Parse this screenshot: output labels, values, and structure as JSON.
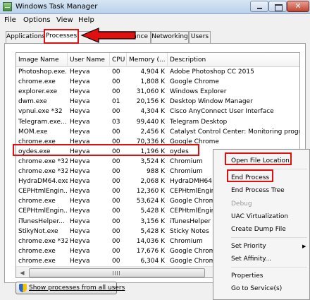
{
  "window": {
    "title": "Windows Task Manager",
    "close_glyph": "✕"
  },
  "menu": [
    "File",
    "Options",
    "View",
    "Help"
  ],
  "tabs": [
    "Applications",
    "Processes",
    "Performance",
    "Networking",
    "Users"
  ],
  "columns": [
    "Image Name",
    "User Name",
    "CPU",
    "Memory (...",
    "Description"
  ],
  "rows": [
    {
      "image": "Photoshop.exe...",
      "user": "Heyva",
      "cpu": "00",
      "memory": "4,904 K",
      "desc": "Adobe Photoshop CC 2015"
    },
    {
      "image": "chrome.exe",
      "user": "Heyva",
      "cpu": "00",
      "memory": "1,808 K",
      "desc": "Google Chrome"
    },
    {
      "image": "explorer.exe",
      "user": "Heyva",
      "cpu": "00",
      "memory": "31,060 K",
      "desc": "Windows Explorer"
    },
    {
      "image": "dwm.exe",
      "user": "Heyva",
      "cpu": "01",
      "memory": "20,156 K",
      "desc": "Desktop Window Manager"
    },
    {
      "image": "vpnui.exe *32",
      "user": "Heyva",
      "cpu": "00",
      "memory": "4,304 K",
      "desc": "Cisco AnyConnect User Interface"
    },
    {
      "image": "Telegram.exe...",
      "user": "Heyva",
      "cpu": "03",
      "memory": "99,440 K",
      "desc": "Telegram Desktop"
    },
    {
      "image": "MOM.exe",
      "user": "Heyva",
      "cpu": "00",
      "memory": "2,456 K",
      "desc": "Catalyst Control Center: Monitoring progra"
    },
    {
      "image": "chrome.exe",
      "user": "Heyva",
      "cpu": "00",
      "memory": "70,336 K",
      "desc": "Google Chrome"
    },
    {
      "image": "oydes.exe",
      "user": "Heyva",
      "cpu": "00",
      "memory": "1,196 K",
      "desc": "oydes"
    },
    {
      "image": "chrome.exe *32",
      "user": "Heyva",
      "cpu": "00",
      "memory": "3,524 K",
      "desc": "Chromium"
    },
    {
      "image": "chrome.exe *32",
      "user": "Heyva",
      "cpu": "00",
      "memory": "988 K",
      "desc": "Chromium"
    },
    {
      "image": "HydraDM64.exe",
      "user": "Heyva",
      "cpu": "00",
      "memory": "2,068 K",
      "desc": "HydraDMH64"
    },
    {
      "image": "CEPHtmlEngin...",
      "user": "Heyva",
      "cpu": "00",
      "memory": "12,360 K",
      "desc": "CEPHtmlEngine"
    },
    {
      "image": "chrome.exe",
      "user": "Heyva",
      "cpu": "00",
      "memory": "53,624 K",
      "desc": "Google Chrome"
    },
    {
      "image": "CEPHtmlEngin...",
      "user": "Heyva",
      "cpu": "00",
      "memory": "5,428 K",
      "desc": "CEPHtmlEngine"
    },
    {
      "image": "iTunesHelper...",
      "user": "Heyva",
      "cpu": "00",
      "memory": "3,156 K",
      "desc": "iTunesHelper"
    },
    {
      "image": "StikyNot.exe",
      "user": "Heyva",
      "cpu": "00",
      "memory": "5,428 K",
      "desc": "Sticky Notes"
    },
    {
      "image": "chrome.exe *32",
      "user": "Heyva",
      "cpu": "00",
      "memory": "14,036 K",
      "desc": "Chromium"
    },
    {
      "image": "chrome.exe",
      "user": "Heyva",
      "cpu": "00",
      "memory": "17,676 K",
      "desc": "Google Chrome"
    },
    {
      "image": "chrome.exe",
      "user": "Heyva",
      "cpu": "00",
      "memory": "6,304 K",
      "desc": "Google Chrome"
    }
  ],
  "scrollbar": {
    "left_glyph": "◀",
    "right_glyph": "▶"
  },
  "show_all_button": "Show processes from all users",
  "context_menu": {
    "items": [
      "Open File Location",
      "End Process",
      "End Process Tree",
      "Debug",
      "UAC Virtualization",
      "Create Dump File",
      "Set Priority",
      "Set Affinity...",
      "Properties",
      "Go to Service(s)"
    ],
    "submenu_glyph": "▶"
  },
  "colors": {
    "annotation": "#e01010",
    "titlebar": "#c6d9ee"
  }
}
